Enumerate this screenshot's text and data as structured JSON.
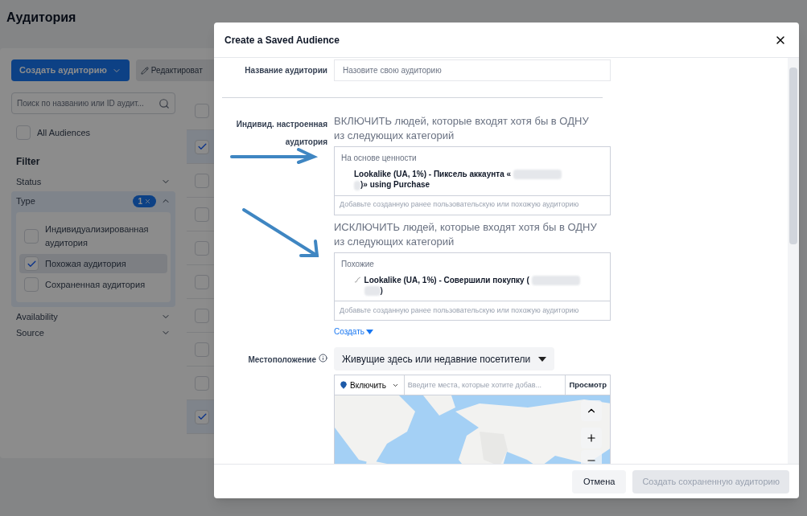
{
  "page": {
    "title": "Аудитория",
    "create_button": "Создать аудиторию",
    "edit_button": "Редактироват",
    "search": {
      "placeholder": "Поиск по названию или ID аудит..."
    },
    "all_audiences": {
      "label": "All Audiences",
      "checked": false
    },
    "filter_title": "Filter",
    "filters": [
      {
        "label": "Status",
        "expanded": false
      },
      {
        "label": "Type",
        "expanded": true,
        "badge": "1",
        "options": [
          {
            "label": "Индивидуализированная аудитория",
            "checked": false
          },
          {
            "label": "Похожая аудитория",
            "checked": true
          },
          {
            "label": "Сохраненная аудитория",
            "checked": false
          }
        ]
      },
      {
        "label": "Availability",
        "expanded": false
      },
      {
        "label": "Source",
        "expanded": false
      }
    ],
    "header_checked": false,
    "table_rows": [
      {
        "selected": true
      },
      {
        "selected": false
      },
      {
        "selected": false
      },
      {
        "selected": false
      },
      {
        "selected": false
      },
      {
        "selected": false
      },
      {
        "selected": false
      },
      {
        "selected": false
      },
      {
        "selected": true
      }
    ]
  },
  "dialog": {
    "title": "Create a Saved Audience",
    "name_field": {
      "label": "Название аудитории",
      "placeholder": "Назовите свою аудиторию"
    },
    "custom_audience": {
      "label": "Индивид. настроенная аудитория",
      "include": {
        "heading": "ВКЛЮЧИТЬ людей, которые входят хотя бы в ОДНУ из следующих категорий",
        "group": "На основе ценности",
        "item_start": "Lookalike (UA, 1%) - Пиксель аккаунта «",
        "item_end": ")» using Purchase",
        "placeholder": "Добавьте созданную ранее пользовательскую или похожую аудиторию"
      },
      "exclude": {
        "heading": "ИСКЛЮЧИТЬ людей, которые входят хотя бы в ОДНУ из следующих категорий",
        "group": "Похожие",
        "item_start": "Lookalike (UA, 1%) - Совершили покупку (",
        "item_end": ")",
        "placeholder": "Добавьте созданную ранее пользовательскую или похожую аудиторию"
      },
      "create_link": "Создать"
    },
    "location": {
      "label": "Местоположение",
      "dropdown": "Живущие здесь или недавние посетители",
      "mode": "Включить",
      "placeholder": "Введите места, которые хотите добав...",
      "browse": "Просмотр"
    },
    "cancel_button": "Отмена",
    "submit_button": {
      "label": "Создать сохраненную аудиторию",
      "disabled": true
    }
  }
}
